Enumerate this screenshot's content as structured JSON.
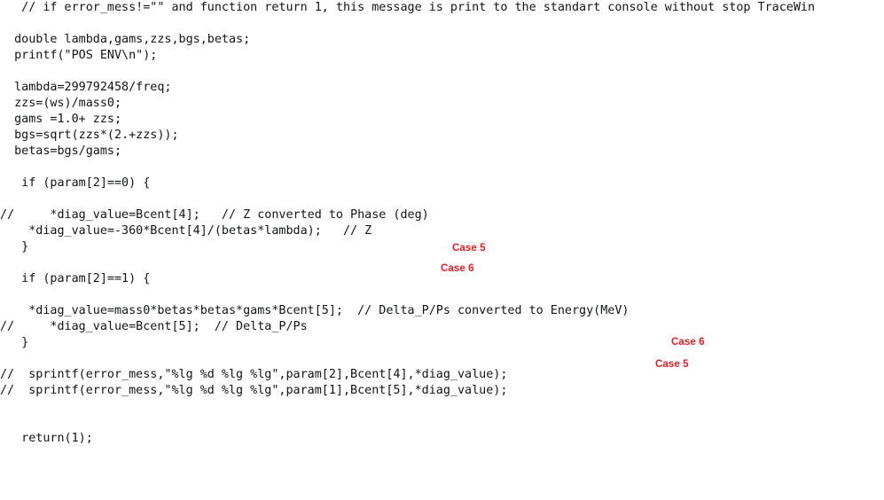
{
  "window": {
    "title": "TraceWin diagnostic code snippet",
    "background_color": "#ffffff",
    "code_text_color": "#111418",
    "annotation_color": "#ea1c22"
  },
  "code": {
    "language": "c",
    "font": "monospace",
    "lines": [
      "   // if error_mess!=\"\" and function return 1, this message is print to the standart console without stop TraceWin",
      "",
      "  double lambda,gams,zzs,bgs,betas;",
      "  printf(\"POS ENV\\n\");",
      "",
      "  lambda=299792458/freq;",
      "  zzs=(ws)/mass0;",
      "  gams =1.0+ zzs;",
      "  bgs=sqrt(zzs*(2.+zzs));",
      "  betas=bgs/gams;",
      "",
      "   if (param[2]==0) {",
      "",
      "//     *diag_value=Bcent[4];   // Z converted to Phase (deg)",
      "    *diag_value=-360*Bcent[4]/(betas*lambda);   // Z",
      "   }",
      "",
      "   if (param[2]==1) {",
      "",
      "    *diag_value=mass0*betas*betas*gams*Bcent[5];  // Delta_P/Ps converted to Energy(MeV)",
      "//     *diag_value=Bcent[5];  // Delta_P/Ps",
      "   }",
      "",
      "//  sprintf(error_mess,\"%lg %d %lg %lg\",param[2],Bcent[4],*diag_value);",
      "//  sprintf(error_mess,\"%lg %d %lg %lg\",param[1],Bcent[5],*diag_value);",
      "",
      "",
      "   return(1);"
    ]
  },
  "annotations": {
    "items": [
      {
        "id": "case-a1",
        "label": "Case 5",
        "refers_to_line": 13
      },
      {
        "id": "case-a2",
        "label": "Case 6",
        "refers_to_line": 14
      },
      {
        "id": "case-b1",
        "label": "Case 6",
        "refers_to_line": 19
      },
      {
        "id": "case-b2",
        "label": "Case 5",
        "refers_to_line": 20
      }
    ],
    "case_a1_label": "Case 5",
    "case_a2_label": "Case 6",
    "case_b1_label": "Case 6",
    "case_b2_label": "Case 5"
  }
}
